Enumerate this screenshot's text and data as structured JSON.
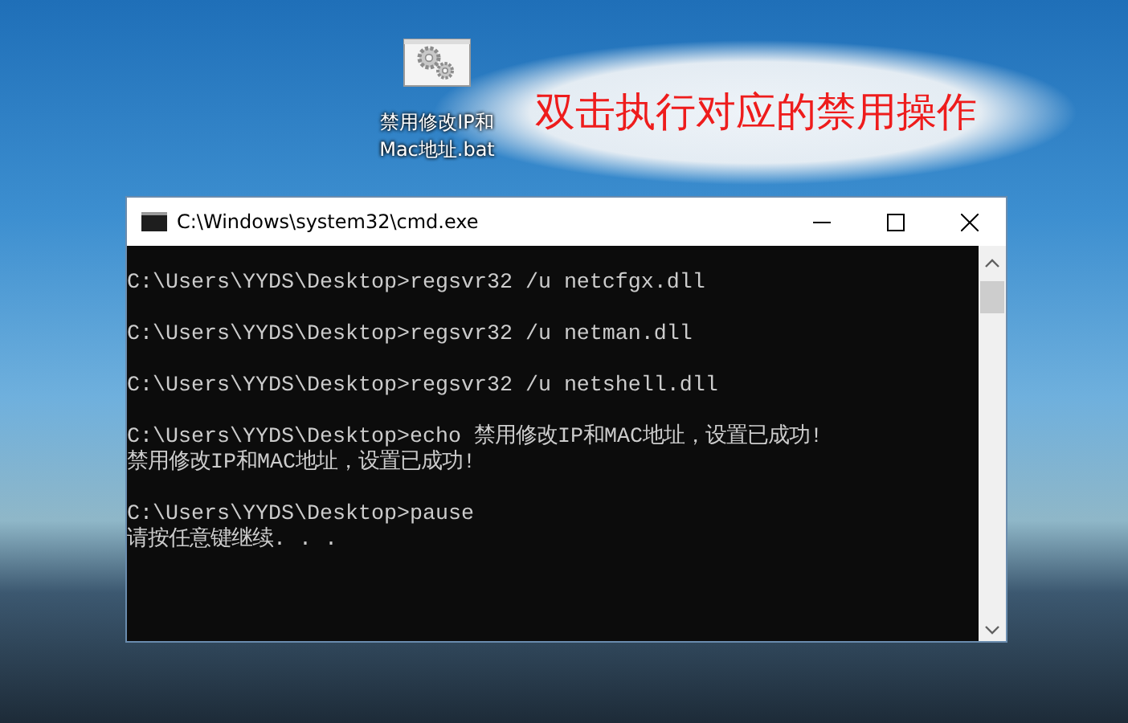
{
  "desktop": {
    "icon": {
      "label": "禁用修改IP和Mac地址.bat"
    },
    "annotation": "双击执行对应的禁用操作"
  },
  "window": {
    "title": "C:\\Windows\\system32\\cmd.exe",
    "console": [
      {
        "kind": "prompt",
        "text": "C:\\Users\\YYDS\\Desktop>regsvr32 /u netcfgx.dll"
      },
      {
        "kind": "prompt",
        "text": "C:\\Users\\YYDS\\Desktop>regsvr32 /u netman.dll"
      },
      {
        "kind": "prompt",
        "text": "C:\\Users\\YYDS\\Desktop>regsvr32 /u netshell.dll"
      },
      {
        "kind": "prompt",
        "text": "C:\\Users\\YYDS\\Desktop>echo 禁用修改IP和MAC地址，设置已成功!"
      },
      {
        "kind": "output",
        "text": "禁用修改IP和MAC地址，设置已成功!"
      },
      {
        "kind": "prompt",
        "text": "C:\\Users\\YYDS\\Desktop>pause"
      },
      {
        "kind": "output",
        "text": "请按任意键继续. . ."
      }
    ]
  }
}
